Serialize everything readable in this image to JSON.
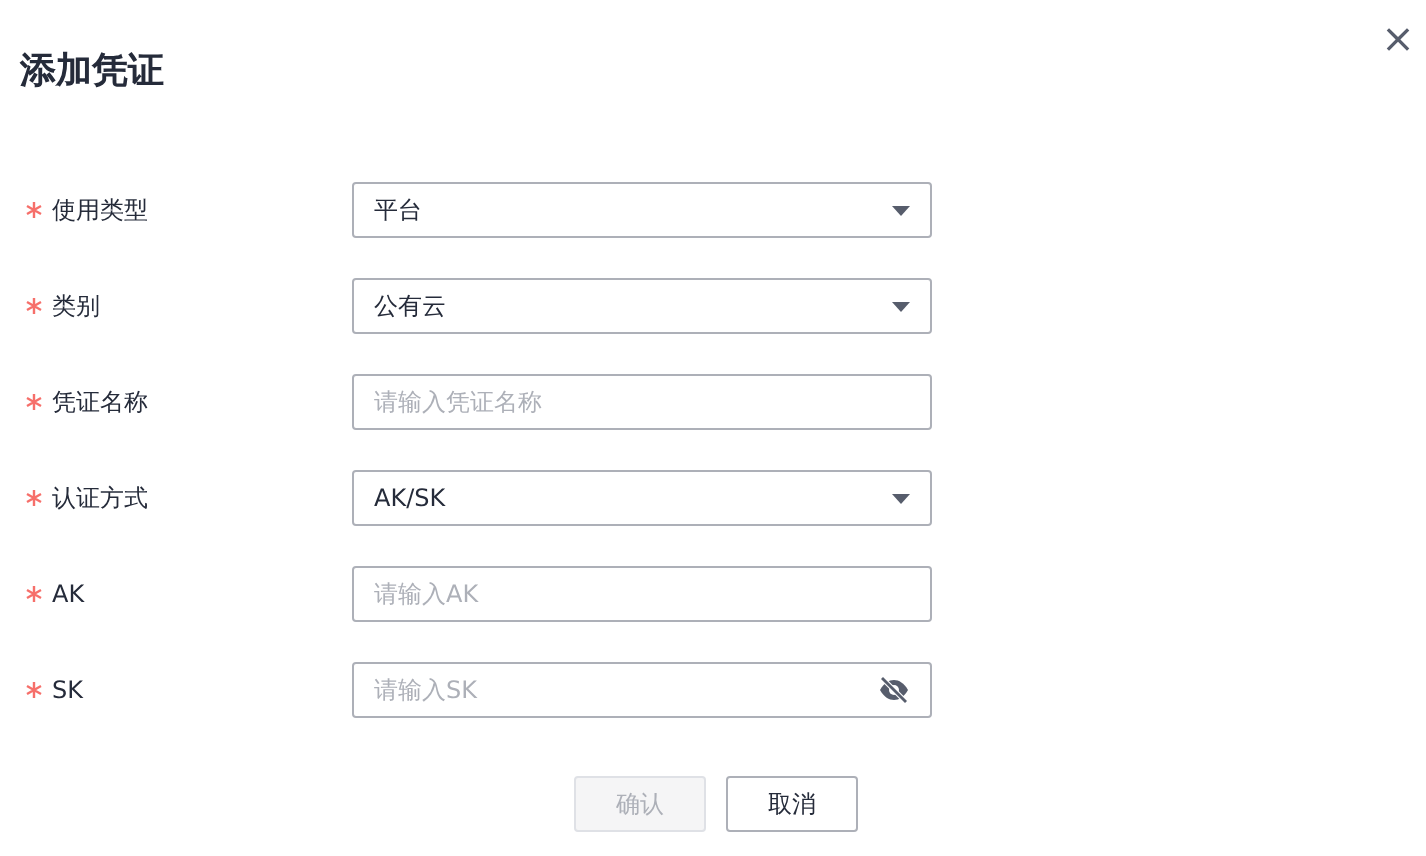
{
  "dialog": {
    "title": "添加凭证",
    "close": "×"
  },
  "fields": [
    {
      "label": "使用类型",
      "required": true,
      "kind": "select",
      "value": "平台"
    },
    {
      "label": "类别",
      "required": true,
      "kind": "select",
      "value": "公有云"
    },
    {
      "label": "凭证名称",
      "required": true,
      "kind": "input",
      "placeholder": "请输入凭证名称"
    },
    {
      "label": "认证方式",
      "required": true,
      "kind": "select",
      "value": "AK/SK"
    },
    {
      "label": "AK",
      "required": true,
      "kind": "input",
      "placeholder": "请输入AK"
    },
    {
      "label": "SK",
      "required": true,
      "kind": "password",
      "placeholder": "请输入SK"
    }
  ],
  "buttons": [
    {
      "label": "确认",
      "disabled": true
    },
    {
      "label": "取消",
      "disabled": false
    }
  ]
}
